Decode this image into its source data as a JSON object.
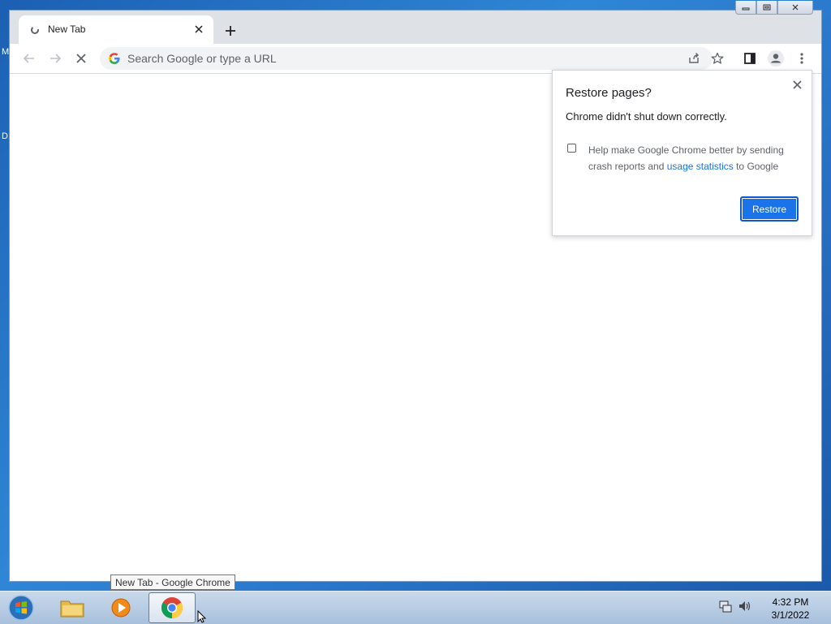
{
  "desktop": {
    "left_fragment_1": "M",
    "left_fragment_2": "D"
  },
  "browser": {
    "tab": {
      "title": "New Tab",
      "close_glyph": "✕"
    },
    "new_tab_glyph": "+",
    "window_controls": {
      "minimize": "▭",
      "maximize": "⧉",
      "close": "✕"
    },
    "omnibox": {
      "placeholder": "Search Google or type a URL",
      "value": ""
    },
    "accent": "#1a73e8"
  },
  "dialog": {
    "title": "Restore pages?",
    "message": "Chrome didn't shut down correctly.",
    "checkbox_checked": false,
    "checkbox_text_before": "Help make Google Chrome better by sending crash reports and ",
    "checkbox_link": "usage statistics",
    "checkbox_text_after": " to Google",
    "restore_label": "Restore",
    "close_glyph": "✕"
  },
  "tooltip": {
    "text": "New Tab - Google Chrome"
  },
  "taskbar": {
    "items": [
      "start-orb",
      "file-explorer",
      "media-player",
      "google-chrome"
    ],
    "clock": {
      "time": "4:32 PM",
      "date": "3/1/2022"
    }
  }
}
